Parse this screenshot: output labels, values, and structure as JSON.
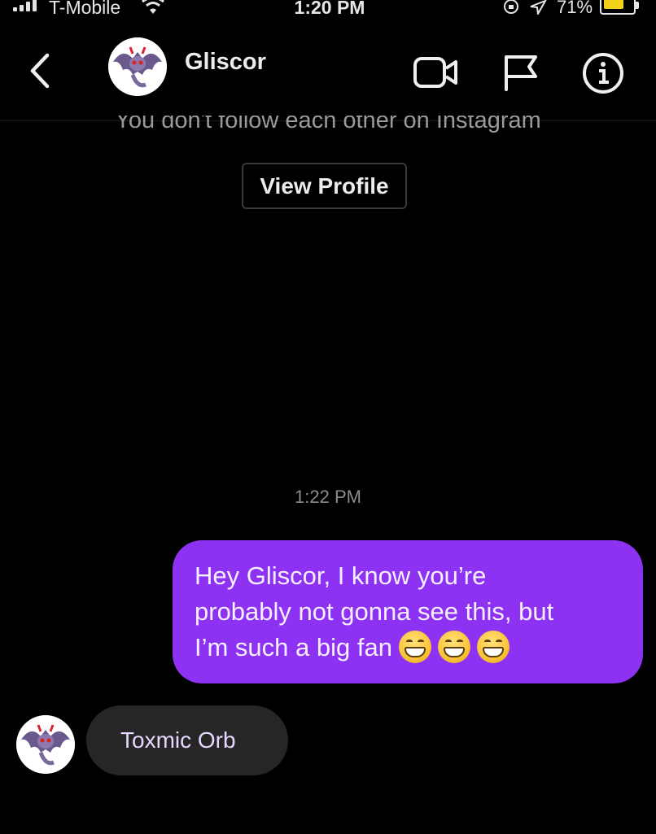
{
  "status_bar": {
    "carrier": "T-Mobile",
    "time": "1:20 PM",
    "battery": "71%",
    "battery_level": 0.71,
    "battery_color": "#f5d21a"
  },
  "header": {
    "contact_name": "Gliscor",
    "icons": [
      "back-chevron-icon",
      "video-call-icon",
      "flag-icon",
      "info-icon"
    ]
  },
  "profile_card": {
    "follow_note": "You don't follow each other on Instagram",
    "view_profile_label": "View Profile"
  },
  "conversation": {
    "timestamp": "1:22 PM",
    "sent_message": {
      "lines": [
        "Hey  Gliscor, I know you’re",
        "probably not gonna see this, but",
        "I’m such a big fan"
      ],
      "emoji": [
        "grinning-face",
        "grinning-face",
        "grinning-face"
      ],
      "bubble_color": "#8d31f2"
    },
    "received_message": {
      "text": "Toxmic Orb",
      "bubble_color": "#262626"
    }
  }
}
